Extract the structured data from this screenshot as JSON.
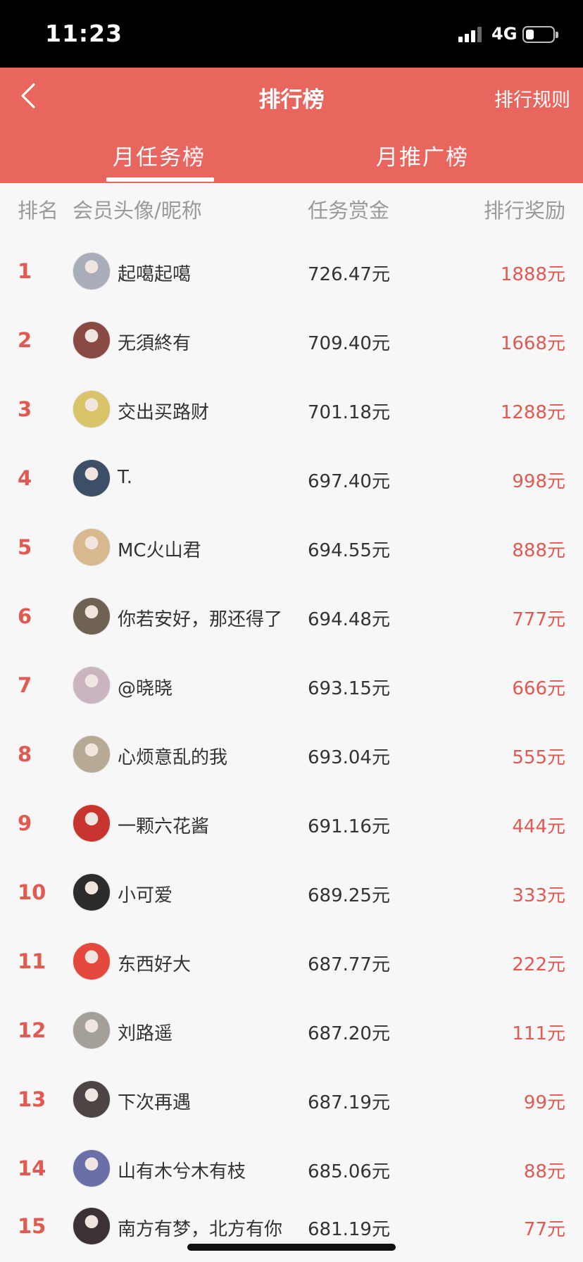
{
  "status_bar": {
    "time": "11:23",
    "network": "4G",
    "battery_level": 0.3
  },
  "header": {
    "title": "排行榜",
    "rules_label": "排行规则",
    "back_icon": "chevron-left-icon"
  },
  "tabs": [
    {
      "label": "月任务榜",
      "active": true
    },
    {
      "label": "月推广榜",
      "active": false
    }
  ],
  "columns": {
    "rank": "排名",
    "member": "会员头像/昵称",
    "task_reward": "任务赏金",
    "prize": "排行奖励"
  },
  "rows": [
    {
      "rank": "1",
      "nickname": "起噶起噶",
      "task_reward": "726.47元",
      "prize": "1888元",
      "avatar_color": "#a8adb9"
    },
    {
      "rank": "2",
      "nickname": "无須終有",
      "task_reward": "709.40元",
      "prize": "1668元",
      "avatar_color": "#8a4a44"
    },
    {
      "rank": "3",
      "nickname": "交出买路财",
      "task_reward": "701.18元",
      "prize": "1288元",
      "avatar_color": "#d9c46a"
    },
    {
      "rank": "4",
      "nickname": "T.",
      "task_reward": "697.40元",
      "prize": "998元",
      "avatar_color": "#3d4f66"
    },
    {
      "rank": "5",
      "nickname": "MC火山君",
      "task_reward": "694.55元",
      "prize": "888元",
      "avatar_color": "#d8b88e"
    },
    {
      "rank": "6",
      "nickname": "你若安好，那还得了",
      "task_reward": "694.48元",
      "prize": "777元",
      "avatar_color": "#6f6253"
    },
    {
      "rank": "7",
      "nickname": "@晓晓",
      "task_reward": "693.15元",
      "prize": "666元",
      "avatar_color": "#c9b4c0"
    },
    {
      "rank": "8",
      "nickname": "心烦意乱的我",
      "task_reward": "693.04元",
      "prize": "555元",
      "avatar_color": "#b7aa95"
    },
    {
      "rank": "9",
      "nickname": "一颗六花酱",
      "task_reward": "691.16元",
      "prize": "444元",
      "avatar_color": "#c8352e"
    },
    {
      "rank": "10",
      "nickname": "小可爱",
      "task_reward": "689.25元",
      "prize": "333元",
      "avatar_color": "#2c2c2c"
    },
    {
      "rank": "11",
      "nickname": "东西好大",
      "task_reward": "687.77元",
      "prize": "222元",
      "avatar_color": "#e5483c"
    },
    {
      "rank": "12",
      "nickname": "刘路遥",
      "task_reward": "687.20元",
      "prize": "111元",
      "avatar_color": "#a49f99"
    },
    {
      "rank": "13",
      "nickname": "下次再遇",
      "task_reward": "687.19元",
      "prize": "99元",
      "avatar_color": "#4d4544"
    },
    {
      "rank": "14",
      "nickname": "山有木兮木有枝",
      "task_reward": "685.06元",
      "prize": "88元",
      "avatar_color": "#6a6fa8"
    },
    {
      "rank": "15",
      "nickname": "南方有梦，北方有你",
      "task_reward": "681.19元",
      "prize": "77元",
      "avatar_color": "#3c3236"
    }
  ],
  "colors": {
    "brand": "#e8665e",
    "rank_red": "#e05a52"
  }
}
